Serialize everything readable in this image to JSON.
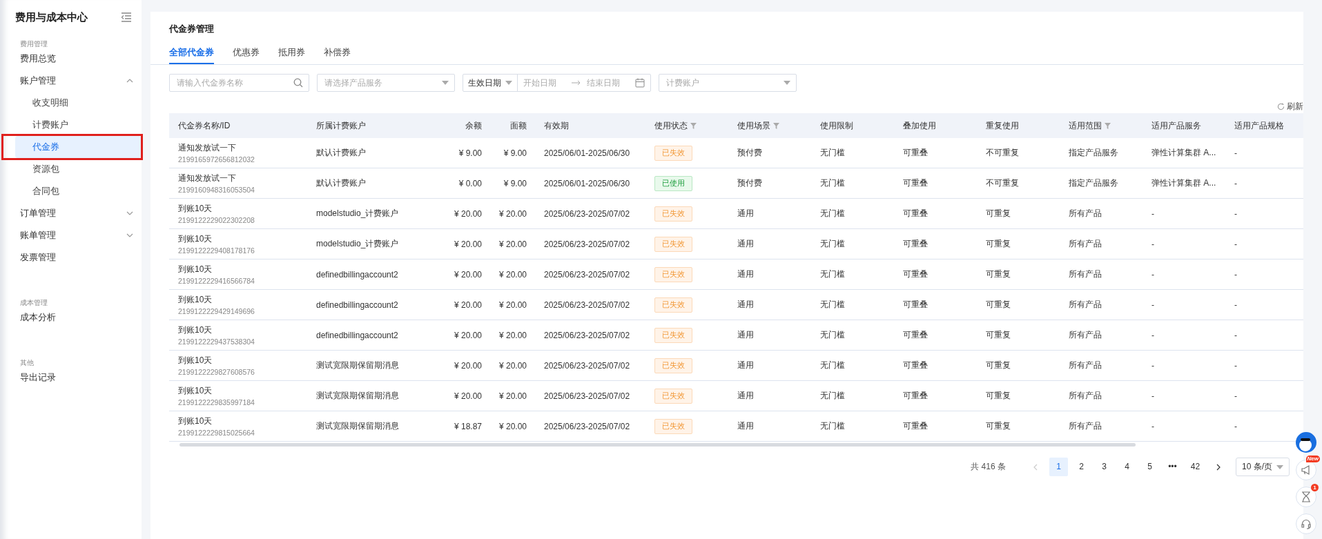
{
  "sidebar": {
    "title": "费用与成本中心",
    "sections": [
      {
        "label": "费用管理",
        "items": [
          {
            "label": "费用总览",
            "selected": false
          },
          {
            "label": "账户管理",
            "selected": false,
            "expanded": true,
            "children": [
              {
                "label": "收支明细",
                "selected": false
              },
              {
                "label": "计费账户",
                "selected": false
              },
              {
                "label": "代金券",
                "selected": true
              },
              {
                "label": "资源包",
                "selected": false
              },
              {
                "label": "合同包",
                "selected": false
              }
            ]
          },
          {
            "label": "订单管理",
            "selected": false,
            "expanded": false
          },
          {
            "label": "账单管理",
            "selected": false,
            "expanded": false
          },
          {
            "label": "发票管理",
            "selected": false
          }
        ]
      },
      {
        "label": "成本管理",
        "items": [
          {
            "label": "成本分析",
            "selected": false
          }
        ]
      },
      {
        "label": "其他",
        "items": [
          {
            "label": "导出记录",
            "selected": false
          }
        ]
      }
    ]
  },
  "page_title": "代金券管理",
  "tabs": [
    {
      "label": "全部代金券",
      "selected": true
    },
    {
      "label": "优惠券",
      "selected": false
    },
    {
      "label": "抵用券",
      "selected": false
    },
    {
      "label": "补偿券",
      "selected": false
    }
  ],
  "filters": {
    "search": {
      "placeholder": "请输入代金券名称"
    },
    "product": {
      "placeholder": "请选择产品服务"
    },
    "date_type": "生效日期",
    "start": {
      "placeholder": "开始日期"
    },
    "end": {
      "placeholder": "结束日期"
    },
    "account": {
      "placeholder": "计费账户"
    }
  },
  "refresh": "刷新",
  "table": {
    "columns": [
      {
        "label": "代金券名称/ID",
        "filter": false
      },
      {
        "label": "所属计费账户",
        "filter": false
      },
      {
        "label": "余额",
        "filter": false
      },
      {
        "label": "面额",
        "filter": false
      },
      {
        "label": "有效期",
        "filter": false
      },
      {
        "label": "使用状态",
        "filter": true
      },
      {
        "label": "使用场景",
        "filter": true
      },
      {
        "label": "使用限制",
        "filter": false
      },
      {
        "label": "叠加使用",
        "filter": false
      },
      {
        "label": "重复使用",
        "filter": false
      },
      {
        "label": "适用范围",
        "filter": true
      },
      {
        "label": "适用产品服务",
        "filter": false
      },
      {
        "label": "适用产品规格",
        "filter": false
      }
    ],
    "rows": [
      {
        "name": "通知发放试一下",
        "id": "2199165972656812032",
        "account": "默认计费账户",
        "balance": "¥ 9.00",
        "face": "¥ 9.00",
        "period": "2025/06/01-2025/06/30",
        "status": {
          "text": "已失效",
          "kind": "expired"
        },
        "scene": "预付费",
        "limit": "无门槛",
        "stack": "可重叠",
        "repeat": "不可重复",
        "scope": "指定产品服务",
        "service": "弹性计算集群 A...",
        "spec": "-"
      },
      {
        "name": "通知发放试一下",
        "id": "2199160948316053504",
        "account": "默认计费账户",
        "balance": "¥ 0.00",
        "face": "¥ 9.00",
        "period": "2025/06/01-2025/06/30",
        "status": {
          "text": "已使用",
          "kind": "used"
        },
        "scene": "预付费",
        "limit": "无门槛",
        "stack": "可重叠",
        "repeat": "不可重复",
        "scope": "指定产品服务",
        "service": "弹性计算集群 A...",
        "spec": "-"
      },
      {
        "name": "到账10天",
        "id": "2199122229022302208",
        "account": "modelstudio_计费账户",
        "balance": "¥ 20.00",
        "face": "¥ 20.00",
        "period": "2025/06/23-2025/07/02",
        "status": {
          "text": "已失效",
          "kind": "expired"
        },
        "scene": "通用",
        "limit": "无门槛",
        "stack": "可重叠",
        "repeat": "可重复",
        "scope": "所有产品",
        "service": "-",
        "spec": "-"
      },
      {
        "name": "到账10天",
        "id": "2199122229408178176",
        "account": "modelstudio_计费账户",
        "balance": "¥ 20.00",
        "face": "¥ 20.00",
        "period": "2025/06/23-2025/07/02",
        "status": {
          "text": "已失效",
          "kind": "expired"
        },
        "scene": "通用",
        "limit": "无门槛",
        "stack": "可重叠",
        "repeat": "可重复",
        "scope": "所有产品",
        "service": "-",
        "spec": "-"
      },
      {
        "name": "到账10天",
        "id": "2199122229416566784",
        "account": "definedbillingaccount2",
        "balance": "¥ 20.00",
        "face": "¥ 20.00",
        "period": "2025/06/23-2025/07/02",
        "status": {
          "text": "已失效",
          "kind": "expired"
        },
        "scene": "通用",
        "limit": "无门槛",
        "stack": "可重叠",
        "repeat": "可重复",
        "scope": "所有产品",
        "service": "-",
        "spec": "-"
      },
      {
        "name": "到账10天",
        "id": "2199122229429149696",
        "account": "definedbillingaccount2",
        "balance": "¥ 20.00",
        "face": "¥ 20.00",
        "period": "2025/06/23-2025/07/02",
        "status": {
          "text": "已失效",
          "kind": "expired"
        },
        "scene": "通用",
        "limit": "无门槛",
        "stack": "可重叠",
        "repeat": "可重复",
        "scope": "所有产品",
        "service": "-",
        "spec": "-"
      },
      {
        "name": "到账10天",
        "id": "2199122229437538304",
        "account": "definedbillingaccount2",
        "balance": "¥ 20.00",
        "face": "¥ 20.00",
        "period": "2025/06/23-2025/07/02",
        "status": {
          "text": "已失效",
          "kind": "expired"
        },
        "scene": "通用",
        "limit": "无门槛",
        "stack": "可重叠",
        "repeat": "可重复",
        "scope": "所有产品",
        "service": "-",
        "spec": "-"
      },
      {
        "name": "到账10天",
        "id": "2199122229827608576",
        "account": "测试宽限期保留期消息",
        "balance": "¥ 20.00",
        "face": "¥ 20.00",
        "period": "2025/06/23-2025/07/02",
        "status": {
          "text": "已失效",
          "kind": "expired"
        },
        "scene": "通用",
        "limit": "无门槛",
        "stack": "可重叠",
        "repeat": "可重复",
        "scope": "所有产品",
        "service": "-",
        "spec": "-"
      },
      {
        "name": "到账10天",
        "id": "2199122229835997184",
        "account": "测试宽限期保留期消息",
        "balance": "¥ 20.00",
        "face": "¥ 20.00",
        "period": "2025/06/23-2025/07/02",
        "status": {
          "text": "已失效",
          "kind": "expired"
        },
        "scene": "通用",
        "limit": "无门槛",
        "stack": "可重叠",
        "repeat": "可重复",
        "scope": "所有产品",
        "service": "-",
        "spec": "-"
      },
      {
        "name": "到账10天",
        "id": "2199122229815025664",
        "account": "测试宽限期保留期消息",
        "balance": "¥ 18.87",
        "face": "¥ 20.00",
        "period": "2025/06/23-2025/07/02",
        "status": {
          "text": "已失效",
          "kind": "expired"
        },
        "scene": "通用",
        "limit": "无门槛",
        "stack": "可重叠",
        "repeat": "可重复",
        "scope": "所有产品",
        "service": "-",
        "spec": "-"
      }
    ]
  },
  "pagination": {
    "total": "共 416 条",
    "prev_disabled": true,
    "pages": [
      {
        "label": "1",
        "selected": true
      },
      {
        "label": "2",
        "selected": false
      },
      {
        "label": "3",
        "selected": false
      },
      {
        "label": "4",
        "selected": false
      },
      {
        "label": "5",
        "selected": false
      },
      {
        "label": "•••",
        "selected": false
      },
      {
        "label": "42",
        "selected": false
      }
    ],
    "page_size": "10 条/页"
  },
  "float_bar": {
    "announcement_badge": "New",
    "task_badge": "1"
  }
}
